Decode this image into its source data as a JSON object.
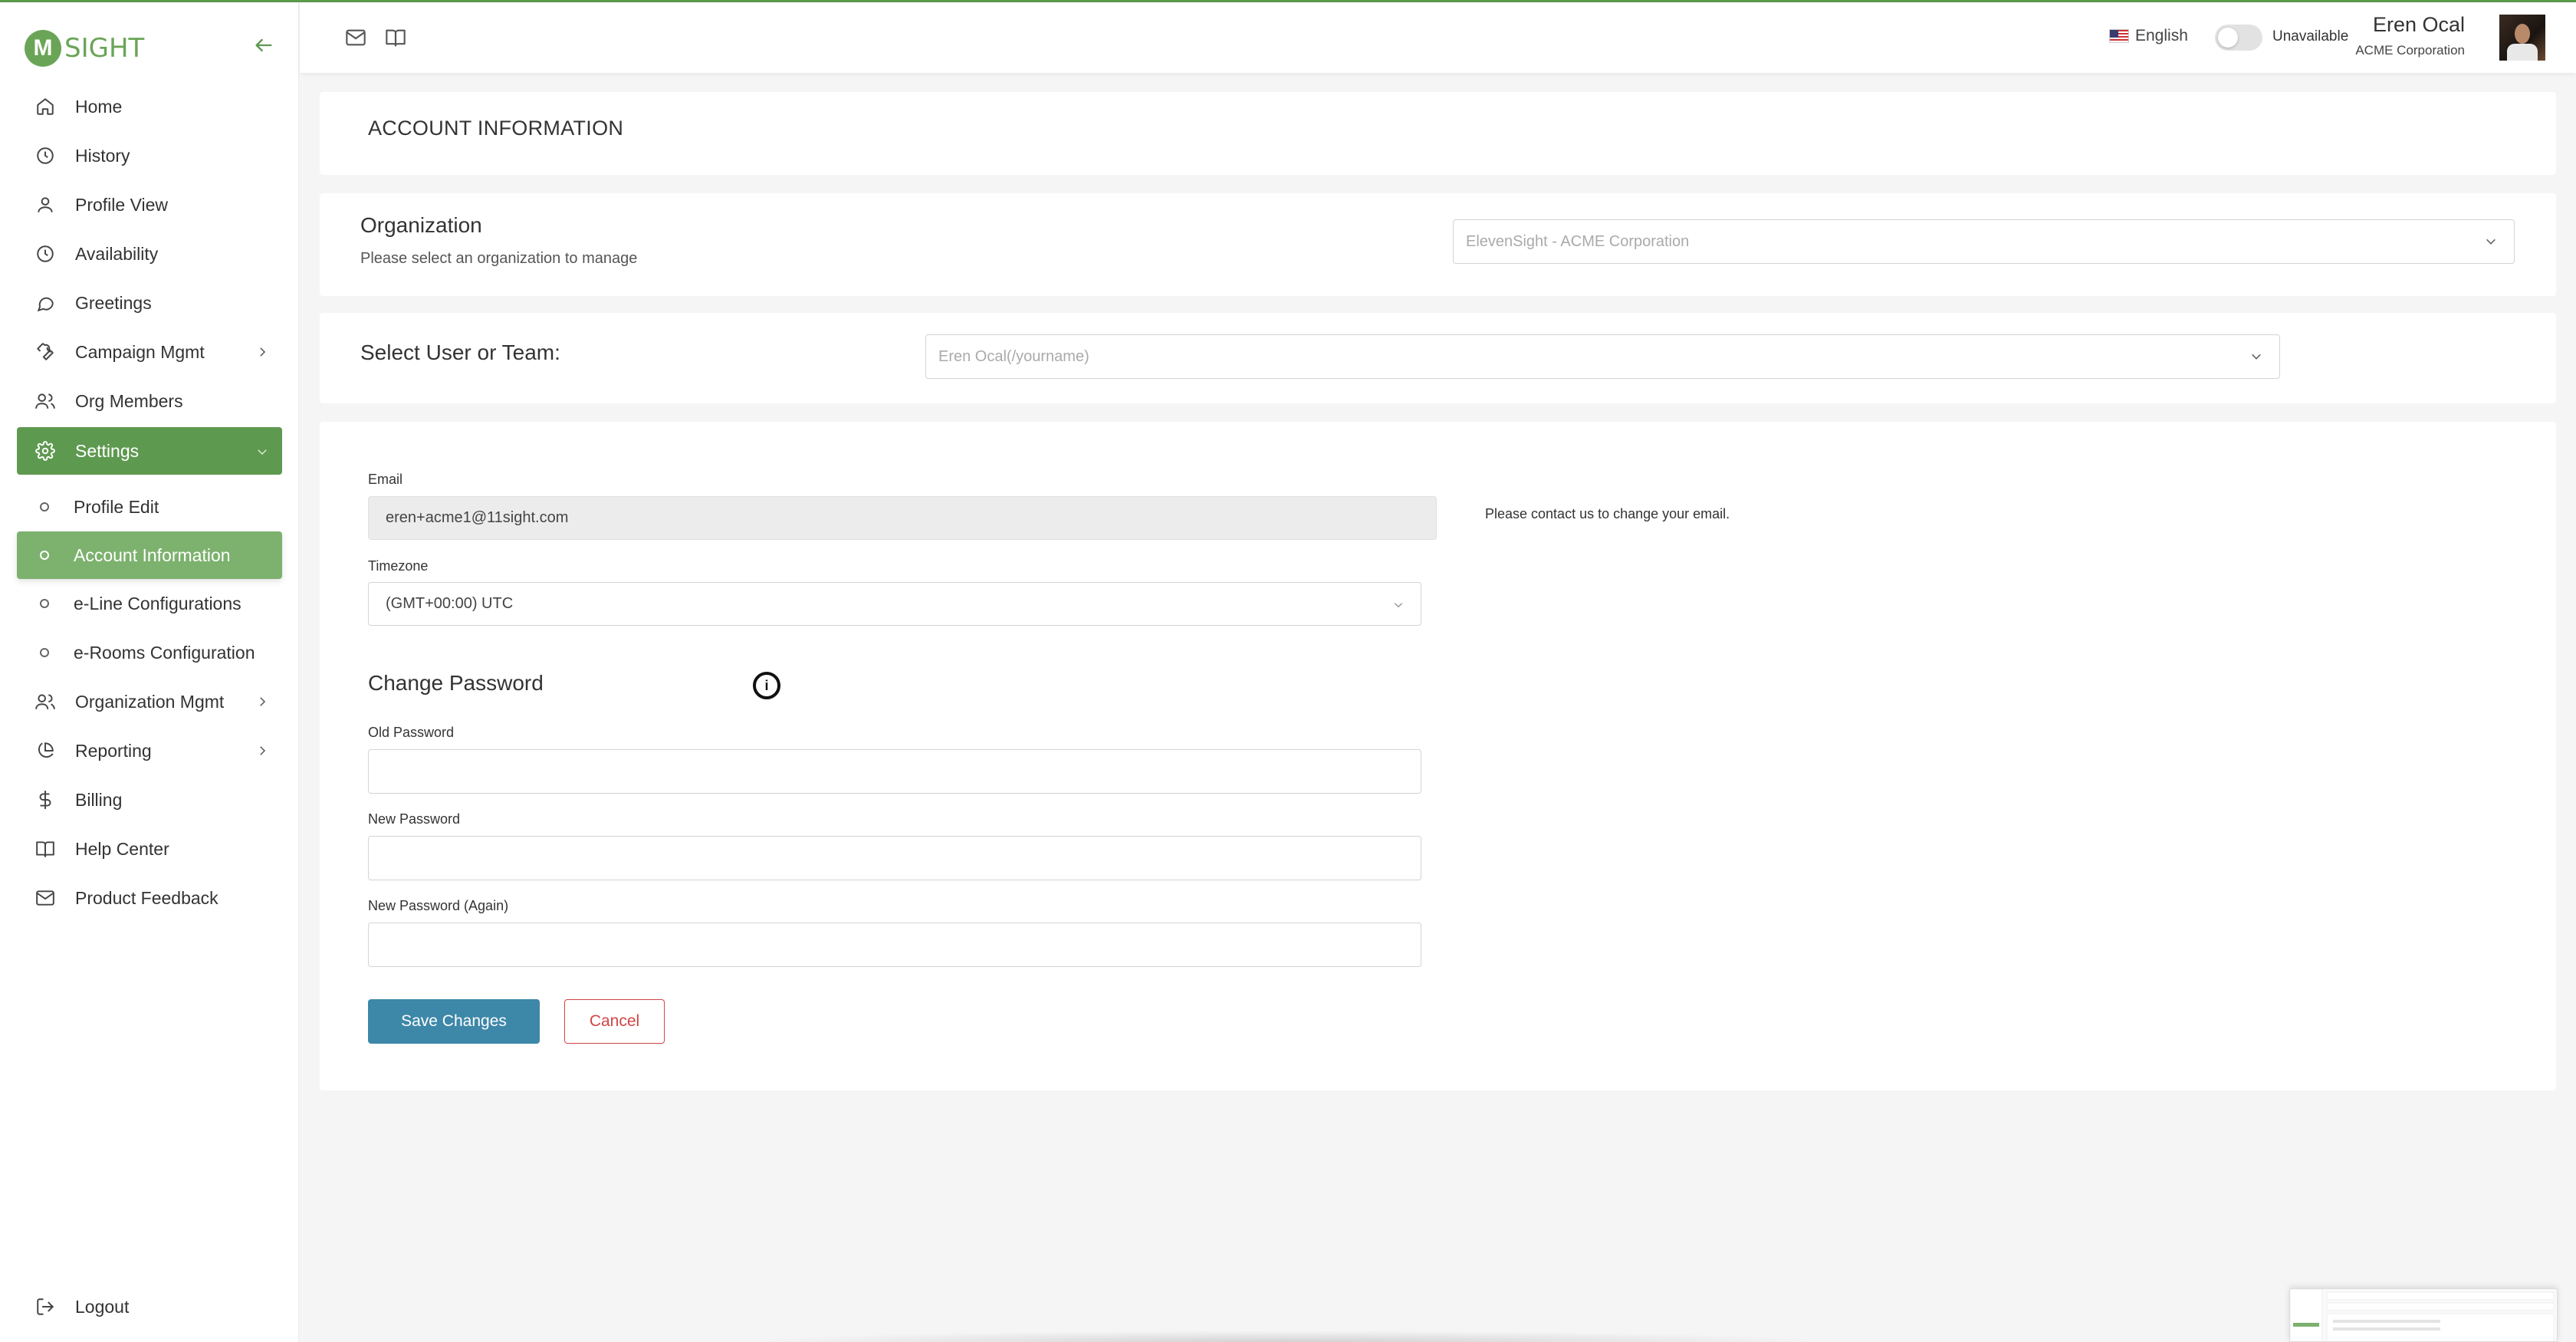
{
  "app": {
    "logo_letter": "M",
    "logo_text": "SIGHT"
  },
  "sidebar": {
    "items": [
      {
        "label": "Home",
        "icon": "home-icon"
      },
      {
        "label": "History",
        "icon": "clock-icon"
      },
      {
        "label": "Profile View",
        "icon": "user-icon"
      },
      {
        "label": "Availability",
        "icon": "clock-icon"
      },
      {
        "label": "Greetings",
        "icon": "chat-bubble-icon"
      },
      {
        "label": "Campaign Mgmt",
        "icon": "wrench-icon"
      },
      {
        "label": "Org Members",
        "icon": "users-icon"
      },
      {
        "label": "Settings",
        "icon": "gear-icon"
      }
    ],
    "sub_items": [
      {
        "label": "Profile Edit"
      },
      {
        "label": "Account Information"
      },
      {
        "label": "e-Line Configurations"
      },
      {
        "label": "e-Rooms Configuration"
      }
    ],
    "items_after": [
      {
        "label": "Organization Mgmt",
        "icon": "users-icon"
      },
      {
        "label": "Reporting",
        "icon": "pie-chart-icon"
      },
      {
        "label": "Billing",
        "icon": "dollar-icon"
      },
      {
        "label": "Help Center",
        "icon": "book-icon"
      },
      {
        "label": "Product Feedback",
        "icon": "mail-icon"
      }
    ],
    "logout_label": "Logout"
  },
  "header": {
    "language": "English",
    "status_label": "Unavailable",
    "user_name": "Eren Ocal",
    "user_org": "ACME Corporation"
  },
  "page": {
    "title": "ACCOUNT INFORMATION"
  },
  "organization": {
    "title": "Organization",
    "subtitle": "Please select an organization to manage",
    "selected": "ElevenSight - ACME Corporation"
  },
  "user_team": {
    "label": "Select User or Team:",
    "selected": "Eren Ocal(/yourname)"
  },
  "form": {
    "email_label": "Email",
    "email_value": "eren+acme1@11sight.com",
    "email_hint": "Please contact us to change your email.",
    "timezone_label": "Timezone",
    "timezone_value": "(GMT+00:00) UTC",
    "change_password_title": "Change Password",
    "old_password_label": "Old Password",
    "new_password_label": "New Password",
    "new_password_again_label": "New Password (Again)",
    "save_label": "Save Changes",
    "cancel_label": "Cancel"
  },
  "colors": {
    "brand_green": "#5e9950",
    "sub_active_green": "#7cb16e",
    "save_blue": "#3d87a8",
    "cancel_red": "#d04545"
  }
}
